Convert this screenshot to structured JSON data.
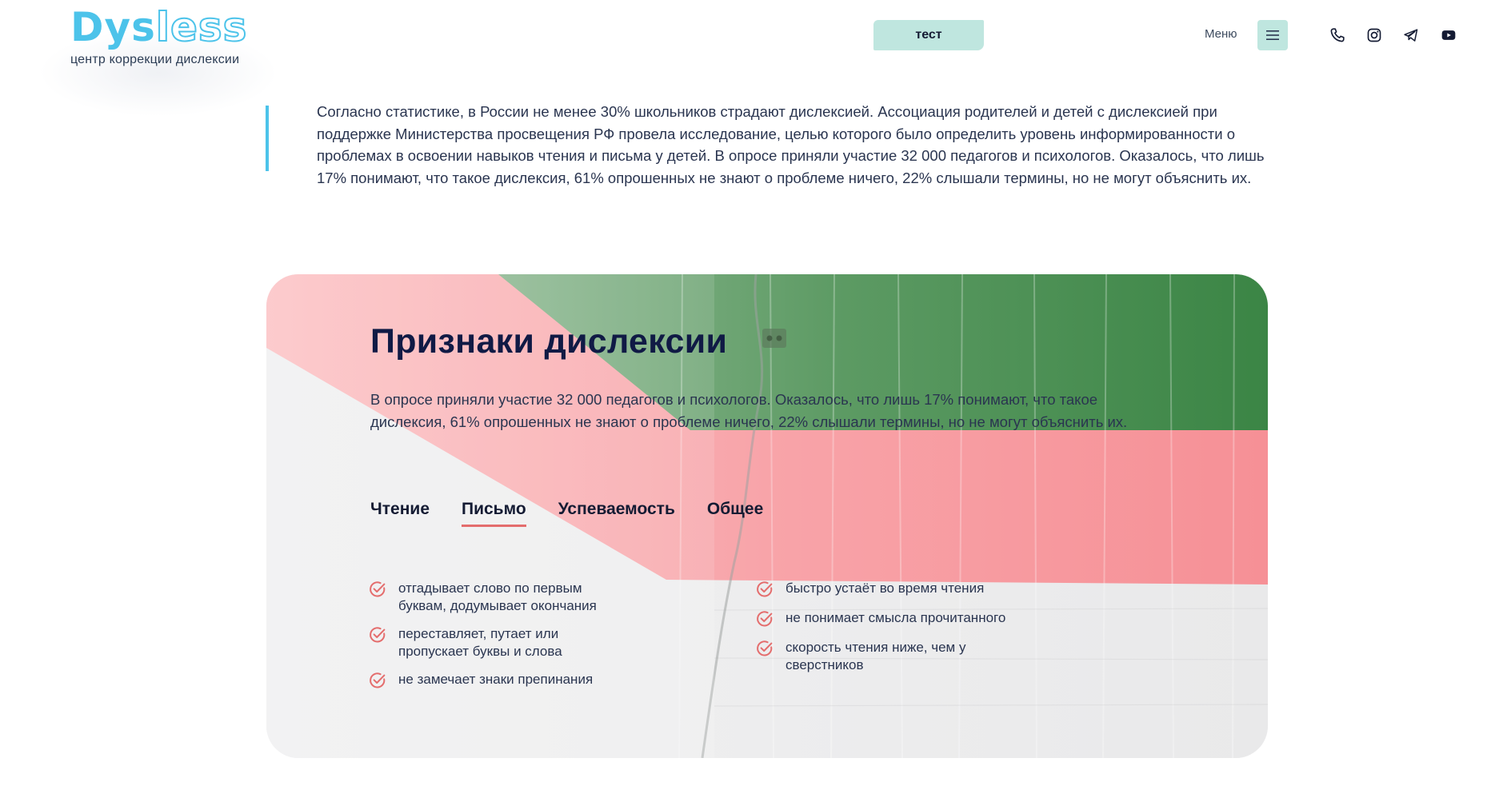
{
  "header": {
    "logo": {
      "part1": "Dys",
      "part2": "less",
      "subtitle": "центр коррекции дислексии"
    },
    "test_label": "тест",
    "menu_label": "Меню",
    "social_icons": [
      "phone-icon",
      "instagram-icon",
      "telegram-icon",
      "youtube-icon"
    ]
  },
  "intro": {
    "text": "Согласно статистике, в России не менее 30% школьников страдают дислексией. Ассоциация родителей и детей с дислексией при поддержке Министерства просвещения РФ провела исследование, целью которого было определить уровень информированности о проблемах в освоении навыков чтения и письма у детей. В опросе приняли участие 32 000 педагогов и психологов. Оказалось, что лишь 17% понимают, что такое дислексия, 61% опрошенных не знают о проблеме ничего, 22% слышали термины, но не могут объяснить их."
  },
  "signs": {
    "title": "Признаки дислексии",
    "description": "В опросе приняли участие 32 000 педагогов и психологов. Оказалось, что лишь 17% понимают, что такое дислексия, 61% опрошенных не знают о проблеме ничего, 22% слышали термины, но не могут объяснить их.",
    "tabs": [
      {
        "label": "Чтение",
        "active": false
      },
      {
        "label": "Письмо",
        "active": true
      },
      {
        "label": "Успеваемость",
        "active": false
      },
      {
        "label": "Общее",
        "active": false
      }
    ],
    "left_items": [
      "отгадывает слово по первым буквам, додумывает окончания",
      "переставляет, путает или пропускает буквы и слова",
      "не замечает знаки препинания"
    ],
    "right_items": [
      "быстро устаёт во время чтения",
      "не понимает смысла прочитанного",
      "скорость чтения ниже, чем у сверстников"
    ]
  },
  "colors": {
    "accent_blue": "#4cc3ea",
    "mint": "#bfe6df",
    "navy": "#101a45",
    "tab_underline": "#e46d6d",
    "check_icon": "#e46d6d",
    "card_green": "#3f8a4a",
    "card_pink": "#f5939a"
  }
}
